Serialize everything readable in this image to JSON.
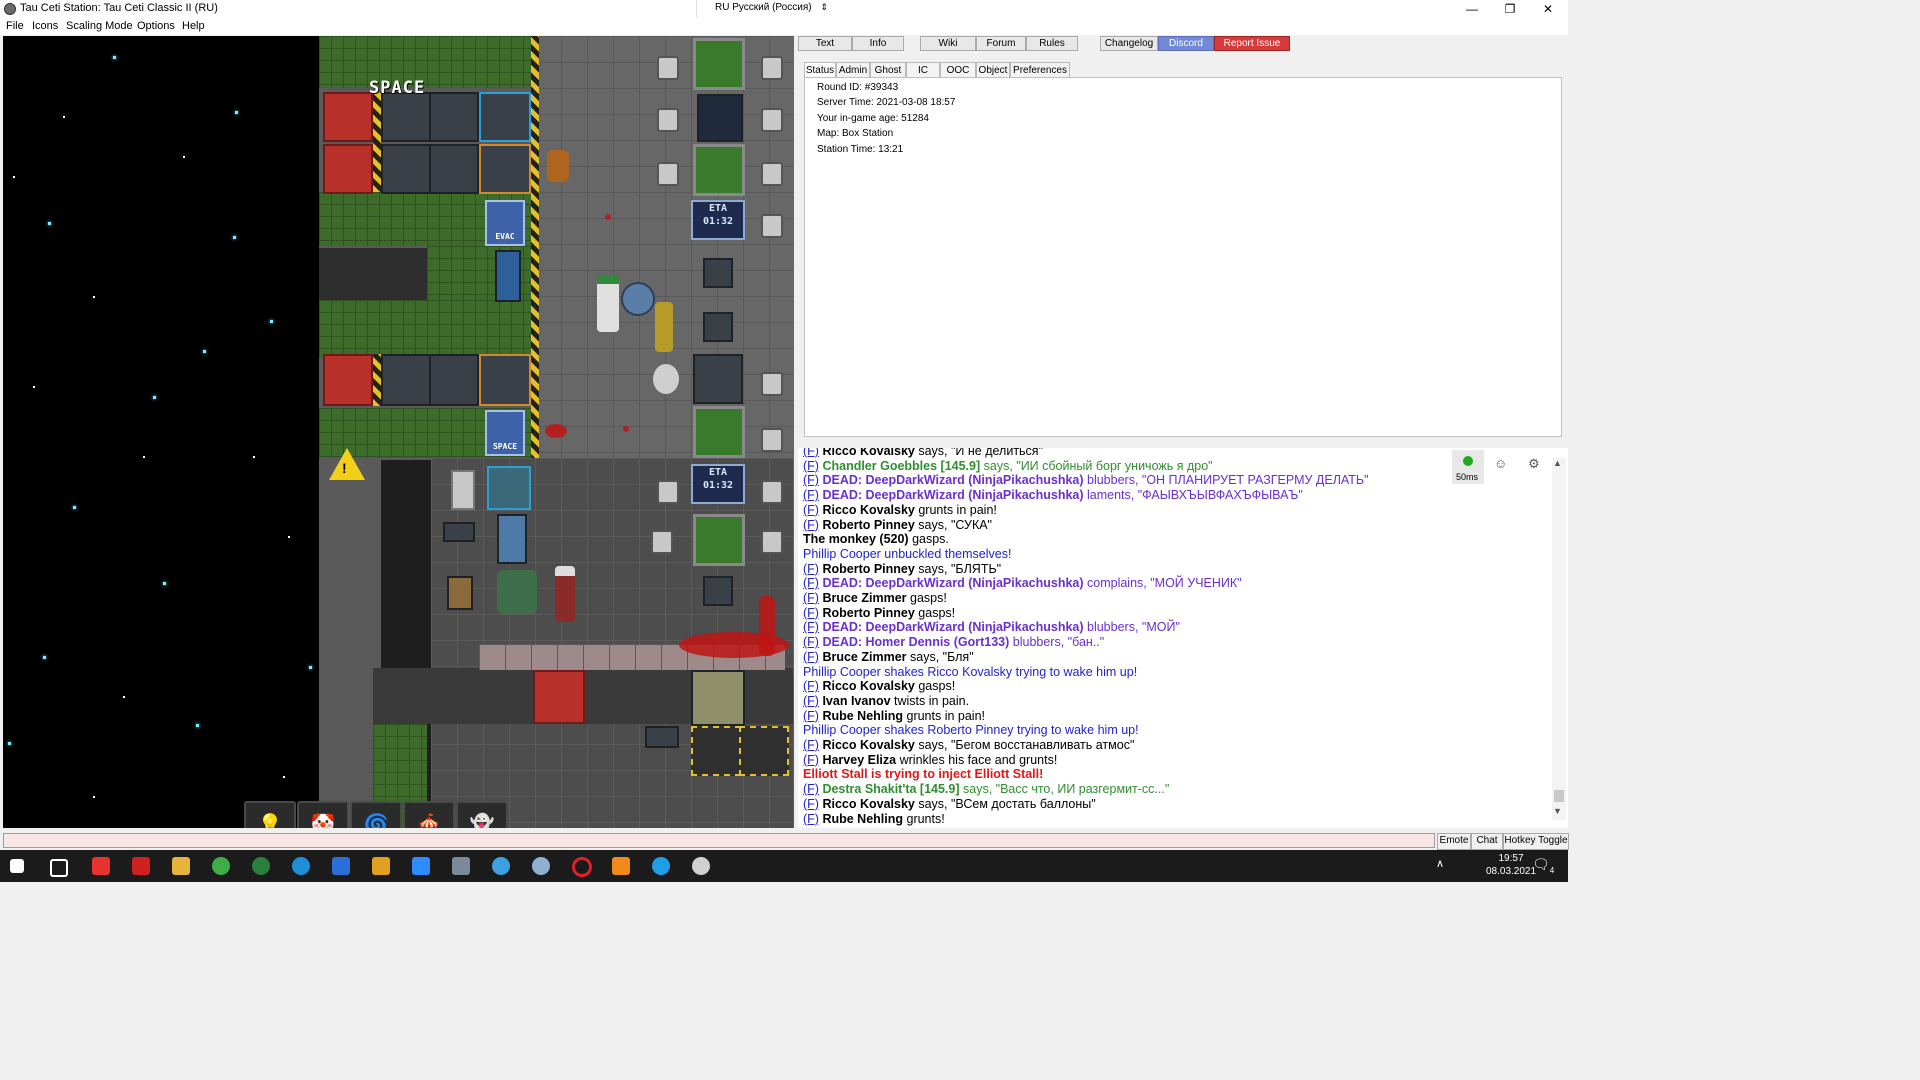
{
  "window": {
    "title": "Tau Ceti Station: Tau Ceti Classic II (RU)",
    "language": "RU Русский (Россия)",
    "controls": [
      "—",
      "❐",
      "✕"
    ]
  },
  "menu": [
    "File",
    "Icons",
    "Scaling Mode",
    "Options",
    "Help"
  ],
  "game": {
    "space_label": "SPACE",
    "evac_sign": "EVAC",
    "space_sign": "SPACE",
    "eta_text": "ETA",
    "eta_time": "01:32"
  },
  "top_buttons": [
    "Text",
    "Info",
    "Wiki",
    "Forum",
    "Rules",
    "Changelog",
    "Discord",
    "Report Issue"
  ],
  "status_tabs": [
    "Status",
    "Admin",
    "Ghost",
    "IC",
    "OOC",
    "Object",
    "Preferences"
  ],
  "status": [
    "Round ID: #39343",
    "Server Time: 2021-03-08 18:57",
    "Your in-game age: 51284",
    "Map: Box Station",
    "Station Time: 13:21"
  ],
  "chat": [
    {
      "tag": "(F)",
      "name": "Ricco Kovalsky",
      "text": " says, \"И не делиться\"",
      "style": "say"
    },
    {
      "tag": "(F)",
      "name": "Chandler Goebbles [145.9]",
      "text": " says, \"ИИ сбойный борг уничожь я дро\"",
      "style": "radio"
    },
    {
      "tag": "(F)",
      "name": "DEAD: DeepDarkWizard (NinjaPikachushka)",
      "text": " blubbers, \"ОН ПЛАНИРУЕТ РАЗГЕРМУ ДЕЛАТЬ\"",
      "style": "dead"
    },
    {
      "tag": "(F)",
      "name": "DEAD: DeepDarkWizard (NinjaPikachushka)",
      "text": " laments, \"ФАЫВХЪЫВФАХЪФЫВАЪ\"",
      "style": "dead"
    },
    {
      "tag": "(F)",
      "name": "Ricco Kovalsky",
      "text": " grunts in pain!",
      "style": "emote"
    },
    {
      "tag": "(F)",
      "name": "Roberto Pinney",
      "text": " says, \"СУКА\"",
      "style": "say"
    },
    {
      "tag": "",
      "name": "The monkey (520)",
      "text": " gasps.",
      "style": "emote"
    },
    {
      "tag": "",
      "name": "",
      "text": "Phillip Cooper unbuckled themselves!",
      "style": "blue"
    },
    {
      "tag": "(F)",
      "name": "Roberto Pinney",
      "text": " says, \"БЛЯТЬ\"",
      "style": "say"
    },
    {
      "tag": "(F)",
      "name": "DEAD: DeepDarkWizard (NinjaPikachushka)",
      "text": " complains, \"МОЙ УЧЕНИК\"",
      "style": "dead"
    },
    {
      "tag": "(F)",
      "name": "Bruce Zimmer",
      "text": " gasps!",
      "style": "emote"
    },
    {
      "tag": "(F)",
      "name": "Roberto Pinney",
      "text": " gasps!",
      "style": "emote"
    },
    {
      "tag": "(F)",
      "name": "DEAD: DeepDarkWizard (NinjaPikachushka)",
      "text": " blubbers, \"МОЙ\"",
      "style": "dead"
    },
    {
      "tag": "(F)",
      "name": "DEAD: Homer Dennis (Gort133)",
      "text": " blubbers, \"бан..\"",
      "style": "dead"
    },
    {
      "tag": "(F)",
      "name": "Bruce Zimmer",
      "text": " says, \"Бля\"",
      "style": "say"
    },
    {
      "tag": "",
      "name": "",
      "text": "Phillip Cooper shakes Ricco Kovalsky trying to wake him up!",
      "style": "blue"
    },
    {
      "tag": "(F)",
      "name": "Ricco Kovalsky",
      "text": " gasps!",
      "style": "emote"
    },
    {
      "tag": "(F)",
      "name": "Ivan Ivanov",
      "text": " twists in pain.",
      "style": "emote"
    },
    {
      "tag": "(F)",
      "name": "Rube Nehling",
      "text": " grunts in pain!",
      "style": "emote"
    },
    {
      "tag": "",
      "name": "",
      "text": "Phillip Cooper shakes Roberto Pinney trying to wake him up!",
      "style": "blue"
    },
    {
      "tag": "(F)",
      "name": "Ricco Kovalsky",
      "text": " says, \"Бегом восстанавливать атмос\"",
      "style": "say"
    },
    {
      "tag": "(F)",
      "name": "Harvey Eliza",
      "text": " wrinkles his face and grunts!",
      "style": "emote"
    },
    {
      "tag": "",
      "name": "",
      "text": "Elliott Stall is trying to inject Elliott Stall!",
      "style": "red"
    },
    {
      "tag": "(F)",
      "name": "Destra Shakit'ta [145.9]",
      "text": " says, \"Васс что, ИИ разгермит-сс...\"",
      "style": "radio"
    },
    {
      "tag": "(F)",
      "name": "Ricco Kovalsky",
      "text": " says, \"ВСем достать баллоны\"",
      "style": "say"
    },
    {
      "tag": "(F)",
      "name": "Rube Nehling",
      "text": " grunts!",
      "style": "emote"
    }
  ],
  "ping": "50ms",
  "bottom_buttons": [
    "Emote",
    "Chat",
    "Hotkey Toggle"
  ],
  "taskbar": {
    "time": "19:57",
    "date": "08.03.2021",
    "notifications": "4"
  },
  "colors": {
    "discord": "#7289da",
    "report": "#d63a3a",
    "dead": "#6b2fcf",
    "radio": "#2f8f2f",
    "link": "#2222cc",
    "alert": "#e01818"
  }
}
